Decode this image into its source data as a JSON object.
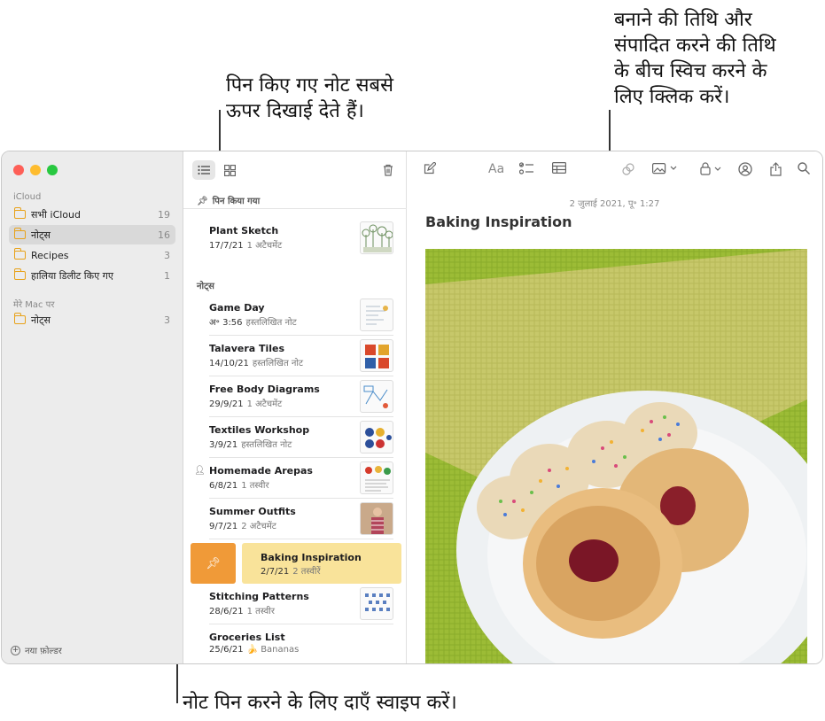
{
  "callouts": {
    "pinned": "पिन किए गए नोट सबसे\nऊपर दिखाई देते हैं।",
    "date_toggle": "बनाने की तिथि और\nसंपादित करने की तिथि\nके बीच स्विच करने के\nलिए क्लिक करें।",
    "swipe": "नोट पिन करने के लिए दाएँ स्वाइप करें।"
  },
  "sidebar": {
    "icloud_label": "iCloud",
    "folders": [
      {
        "label": "सभी iCloud",
        "count": "19"
      },
      {
        "label": "नोट्स",
        "count": "16"
      },
      {
        "label": "Recipes",
        "count": "3"
      },
      {
        "label": "हालिया डिलीट किए गए",
        "count": "1"
      }
    ],
    "mac_label": "मेरे Mac पर",
    "mac_folders": [
      {
        "label": "नोट्स",
        "count": "3"
      }
    ],
    "new_folder": "नया फ़ोल्डर"
  },
  "list": {
    "pinned_header": "पिन किया गया",
    "notes_header": "नोट्स",
    "pinned_notes": [
      {
        "title": "Plant Sketch",
        "date": "17/7/21",
        "sub": "1 अटैचमेंट"
      }
    ],
    "notes": [
      {
        "title": "Game Day",
        "date": "अ॰ 3:56",
        "sub": "हस्तलिखित नोट"
      },
      {
        "title": "Talavera Tiles",
        "date": "14/10/21",
        "sub": "हस्तलिखित नोट"
      },
      {
        "title": "Free Body Diagrams",
        "date": "29/9/21",
        "sub": "1 अटैचमेंट"
      },
      {
        "title": "Textiles Workshop",
        "date": "3/9/21",
        "sub": "हस्तलिखित नोट"
      },
      {
        "title": "Homemade Arepas",
        "date": "6/8/21",
        "sub": "1 तस्वीर"
      },
      {
        "title": "Summer Outfits",
        "date": "9/7/21",
        "sub": "2 अटैचमेंट"
      },
      {
        "title": "Baking Inspiration",
        "date": "2/7/21",
        "sub": "2 तस्वीरें"
      },
      {
        "title": "Stitching Patterns",
        "date": "28/6/21",
        "sub": "1 तस्वीर"
      },
      {
        "title": "Groceries List",
        "date": "25/6/21",
        "sub": "🍌 Bananas"
      }
    ]
  },
  "editor": {
    "date": "2 जुलाई 2021, पू॰ 1:27",
    "title": "Baking Inspiration",
    "format_label": "Aa"
  },
  "colors": {
    "accent": "#f09a38",
    "selected_note": "#f9e39a",
    "folder_icon": "#e8a21a"
  }
}
